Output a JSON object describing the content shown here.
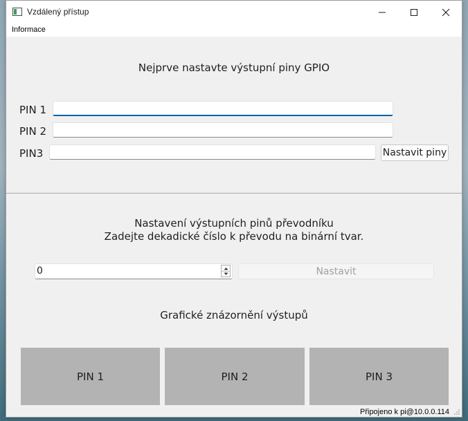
{
  "window": {
    "title": "Vzdálený přístup",
    "icons": {
      "app": "app-window-icon",
      "minimize": "minimize-icon",
      "maximize": "maximize-icon",
      "close": "close-icon"
    }
  },
  "menu": {
    "items": [
      "Informace"
    ]
  },
  "gpio_section": {
    "heading": "Nejprve nastavte výstupní piny GPIO",
    "pins": [
      {
        "label": "PIN 1",
        "value": ""
      },
      {
        "label": "PIN 2",
        "value": ""
      },
      {
        "label": "PIN3",
        "value": ""
      }
    ],
    "set_button": "Nastavit piny"
  },
  "converter_section": {
    "heading_line1": "Nastavení výstupních pinů převodníku",
    "heading_line2": "Zadejte dekadické číslo k převodu na binární tvar.",
    "spin_value": "0",
    "set_button": "Nastavit",
    "set_button_disabled": true
  },
  "graphic_section": {
    "heading": "Grafické znázornění výstupů",
    "outputs": [
      {
        "label": "PIN 1",
        "color": "#b3b3b3"
      },
      {
        "label": "PIN 2",
        "color": "#b3b3b3"
      },
      {
        "label": "PIN 3",
        "color": "#b3b3b3"
      }
    ]
  },
  "status_bar": {
    "text": "Připojeno k pi@10.0.0.114"
  }
}
